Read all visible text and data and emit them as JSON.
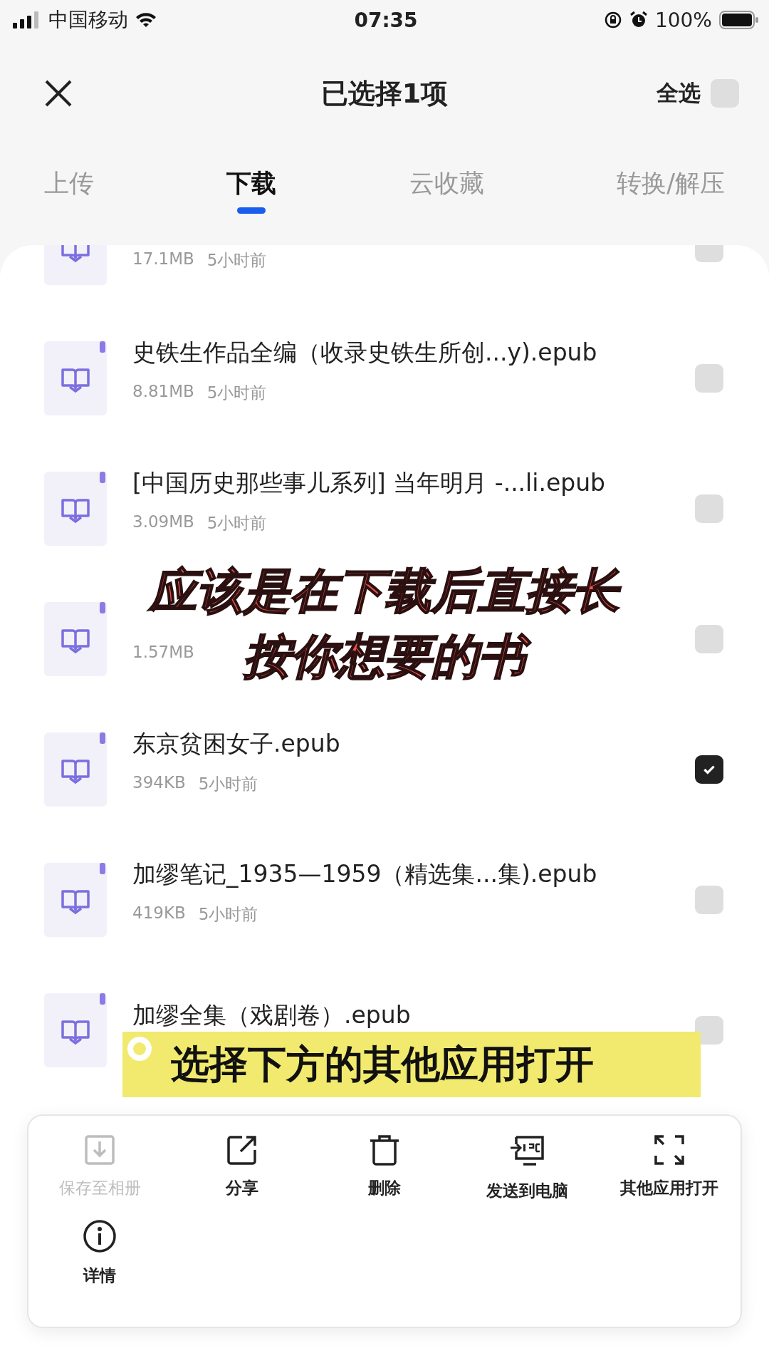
{
  "status_bar": {
    "carrier": "中国移动",
    "time": "07:35",
    "battery": "100%"
  },
  "header": {
    "title": "已选择1项",
    "select_all": {
      "label": "全选",
      "checked": false
    }
  },
  "tabs": [
    {
      "label": "上传",
      "selected": false
    },
    {
      "label": "下载",
      "selected": true
    },
    {
      "label": "云收藏",
      "selected": false
    },
    {
      "label": "转换/解压",
      "selected": false
    }
  ],
  "files": [
    {
      "size": "17.1MB",
      "time": "5小时前",
      "checked": false
    },
    {
      "title": "史铁生作品全编（收录史铁生所创...y).epub",
      "size": "8.81MB",
      "time": "5小时前",
      "checked": false
    },
    {
      "title": "[中国历史那些事儿系列] 当年明月 -...li.epub",
      "size": "3.09MB",
      "time": "5小时前",
      "checked": false
    },
    {
      "size": "1.57MB",
      "checked": false
    },
    {
      "title": "东京贫困女子.epub",
      "size": "394KB",
      "time": "5小时前",
      "checked": true
    },
    {
      "title": "加缪笔记_1935—1959（精选集...集).epub",
      "size": "419KB",
      "time": "5小时前",
      "checked": false
    },
    {
      "title": "加缪全集（戏剧卷）.epub",
      "checked": false
    }
  ],
  "captions": {
    "red": [
      "应该是在下载后直接长",
      "按你想要的书"
    ],
    "yellow": "选择下方的其他应用打开"
  },
  "action_sheet": [
    {
      "kind": "save",
      "label": "保存至相册",
      "disabled": true
    },
    {
      "kind": "share",
      "label": "分享",
      "disabled": false
    },
    {
      "kind": "delete",
      "label": "删除",
      "disabled": false
    },
    {
      "kind": "pc",
      "label": "发送到电脑",
      "disabled": false
    },
    {
      "kind": "expand",
      "label": "其他应用打开",
      "disabled": false
    },
    {
      "kind": "info",
      "label": "详情",
      "disabled": false
    }
  ]
}
